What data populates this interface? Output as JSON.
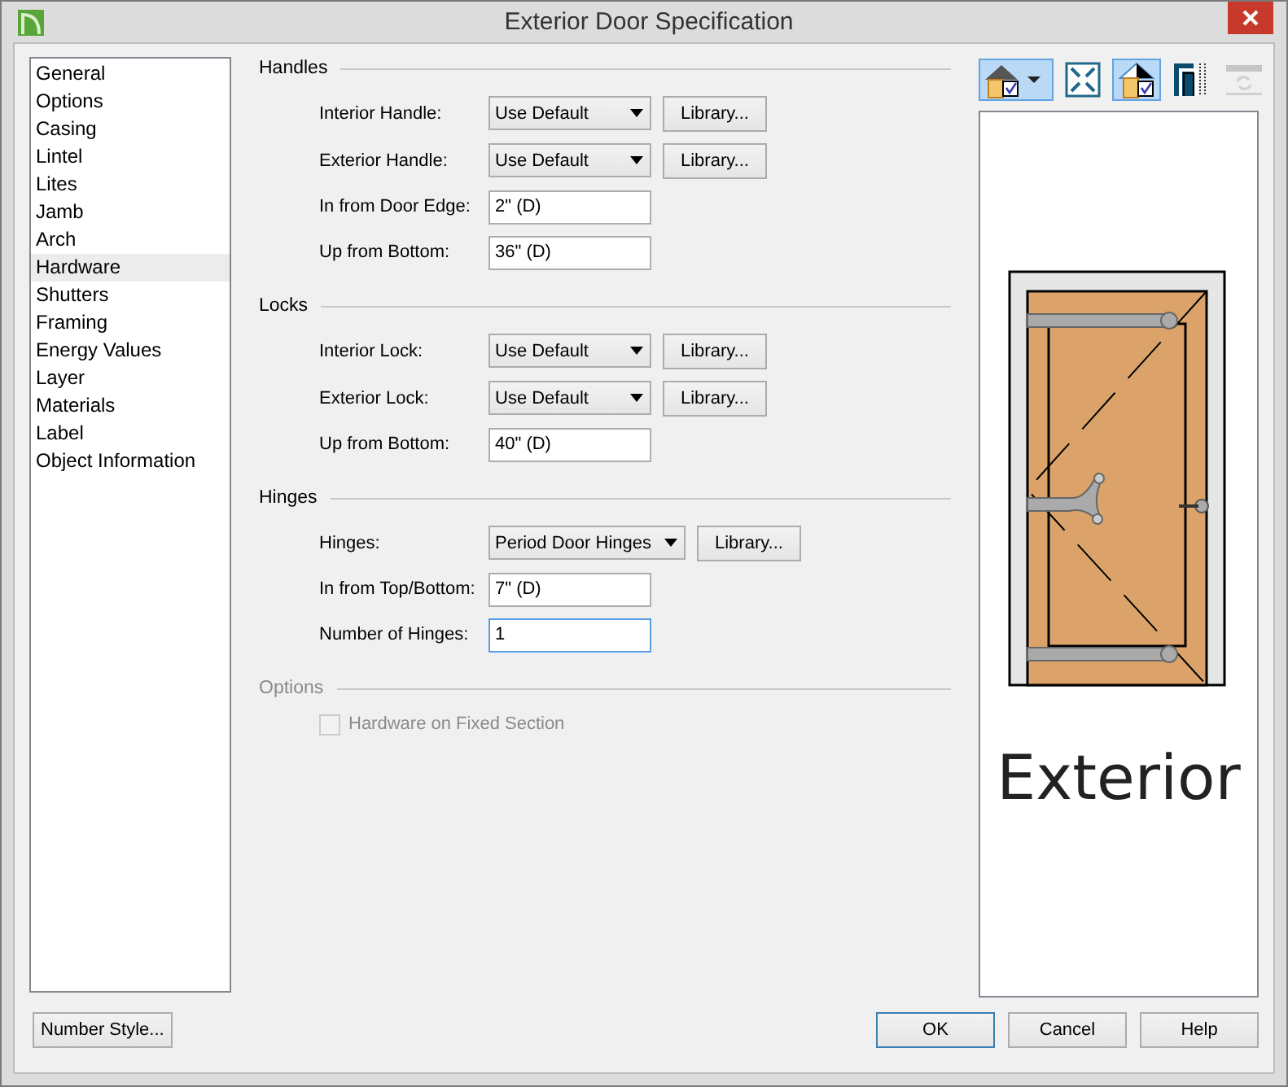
{
  "window": {
    "title": "Exterior Door Specification"
  },
  "nav": {
    "items": [
      {
        "label": "General",
        "selected": false
      },
      {
        "label": "Options",
        "selected": false
      },
      {
        "label": "Casing",
        "selected": false
      },
      {
        "label": "Lintel",
        "selected": false
      },
      {
        "label": "Lites",
        "selected": false
      },
      {
        "label": "Jamb",
        "selected": false
      },
      {
        "label": "Arch",
        "selected": false
      },
      {
        "label": "Hardware",
        "selected": true
      },
      {
        "label": "Shutters",
        "selected": false
      },
      {
        "label": "Framing",
        "selected": false
      },
      {
        "label": "Energy Values",
        "selected": false
      },
      {
        "label": "Layer",
        "selected": false
      },
      {
        "label": "Materials",
        "selected": false
      },
      {
        "label": "Label",
        "selected": false
      },
      {
        "label": "Object Information",
        "selected": false
      }
    ]
  },
  "sections": [
    {
      "title": "Handles",
      "disabled": false,
      "rows": [
        {
          "kind": "dropdown",
          "label": "Interior Handle:",
          "value": "Use Default",
          "button": "Library..."
        },
        {
          "kind": "dropdown",
          "label": "Exterior Handle:",
          "value": "Use Default",
          "button": "Library..."
        },
        {
          "kind": "field",
          "label": "In from Door Edge:",
          "value": "2\" (D)",
          "focused": false
        },
        {
          "kind": "field",
          "label": "Up from Bottom:",
          "value": "36\" (D)",
          "focused": false
        }
      ]
    },
    {
      "title": "Locks",
      "disabled": false,
      "rows": [
        {
          "kind": "dropdown",
          "label": "Interior Lock:",
          "value": "Use Default",
          "button": "Library..."
        },
        {
          "kind": "dropdown",
          "label": "Exterior Lock:",
          "value": "Use Default",
          "button": "Library..."
        },
        {
          "kind": "field",
          "label": "Up from Bottom:",
          "value": "40\" (D)",
          "focused": false
        }
      ]
    },
    {
      "title": "Hinges",
      "disabled": false,
      "rows": [
        {
          "kind": "dropdown",
          "label": "Hinges:",
          "value": "Period Door Hinges",
          "button": "Library..."
        },
        {
          "kind": "field",
          "label": "In from Top/Bottom:",
          "value": "7\" (D)",
          "focused": false
        },
        {
          "kind": "field",
          "label": "Number of Hinges:",
          "value": "1",
          "focused": true
        }
      ]
    },
    {
      "title": "Options",
      "disabled": true,
      "rows": [
        {
          "kind": "checkbox",
          "label": "Hardware on Fixed Section",
          "checked": false,
          "disabled": true
        }
      ]
    }
  ],
  "preview": {
    "toolbar": [
      {
        "kind": "house-check",
        "selected": true,
        "disabled": false
      },
      {
        "kind": "fit",
        "selected": false,
        "disabled": false
      },
      {
        "kind": "house-half",
        "selected": true,
        "disabled": false
      },
      {
        "kind": "door-frame",
        "selected": false,
        "disabled": false
      },
      {
        "kind": "refresh",
        "selected": false,
        "disabled": true
      }
    ],
    "caption": "Exterior"
  },
  "footer": {
    "left": "Number Style...",
    "buttons": [
      {
        "label": "OK",
        "default": true
      },
      {
        "label": "Cancel",
        "default": false
      },
      {
        "label": "Help",
        "default": false
      }
    ]
  }
}
